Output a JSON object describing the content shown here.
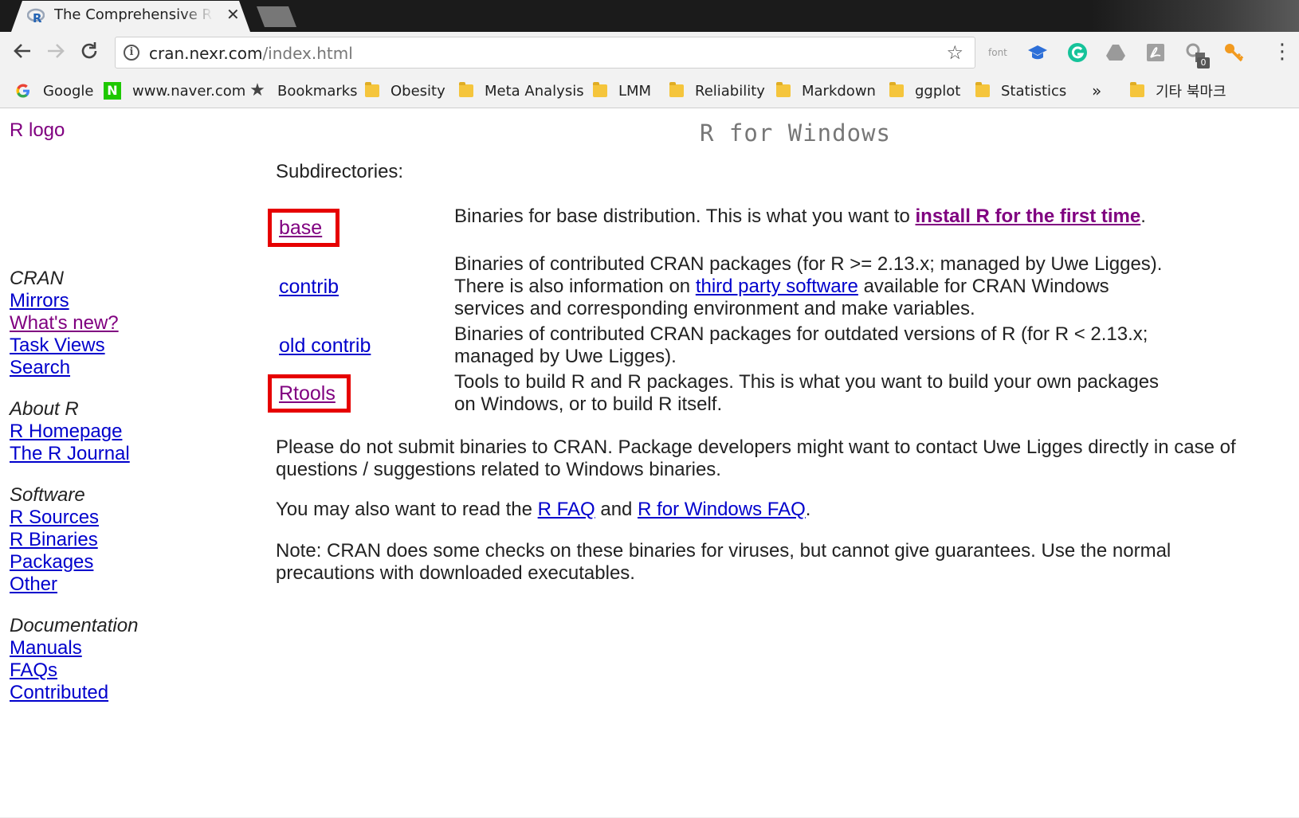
{
  "browser": {
    "tab": {
      "title": "The Comprehensive R Archive Network",
      "close": "✕"
    },
    "url": {
      "host": "cran.nexr.com",
      "path": "/index.html"
    },
    "extension_badge": "0",
    "ext_font_label": "font",
    "bookmarks": [
      {
        "label": "Google",
        "icon": "google-icon"
      },
      {
        "label": "www.naver.com",
        "icon": "naver-icon"
      },
      {
        "label": "Bookmarks",
        "icon": "star-icon"
      },
      {
        "label": "Obesity",
        "icon": "folder-icon"
      },
      {
        "label": "Meta Analysis",
        "icon": "folder-icon"
      },
      {
        "label": "LMM",
        "icon": "folder-icon"
      },
      {
        "label": "Reliability",
        "icon": "folder-icon"
      },
      {
        "label": "Markdown",
        "icon": "folder-icon"
      },
      {
        "label": "ggplot",
        "icon": "folder-icon"
      },
      {
        "label": "Statistics",
        "icon": "folder-icon"
      }
    ],
    "bookmarks_overflow": "»",
    "other_bookmarks": "기타 북마크"
  },
  "page": {
    "logo_alt": "R logo",
    "title": "R for Windows",
    "sidebar": {
      "cran": {
        "heading": "CRAN",
        "links": [
          "Mirrors",
          "What's new?",
          "Task Views",
          "Search"
        ]
      },
      "about": {
        "heading": "About R",
        "links": [
          "R Homepage",
          "The R Journal"
        ]
      },
      "software": {
        "heading": "Software",
        "links": [
          "R Sources",
          "R Binaries",
          "Packages",
          "Other"
        ]
      },
      "documentation": {
        "heading": "Documentation",
        "links": [
          "Manuals",
          "FAQs",
          "Contributed"
        ]
      }
    },
    "subdirectories_heading": "Subdirectories:",
    "dirs": {
      "base": {
        "label": "base",
        "desc_before": "Binaries for base distribution. This is what you want to ",
        "desc_link": "install R for the first time",
        "desc_after": "."
      },
      "contrib": {
        "label": "contrib",
        "desc_before": "Binaries of contributed CRAN packages (for R >= 2.13.x; managed by Uwe Ligges). There is also information on ",
        "desc_link": "third party software",
        "desc_after": " available for CRAN Windows services and corresponding environment and make variables."
      },
      "old_contrib": {
        "label": "old contrib",
        "desc": "Binaries of contributed CRAN packages for outdated versions of R (for R < 2.13.x; managed by Uwe Ligges)."
      },
      "rtools": {
        "label": "Rtools",
        "desc": "Tools to build R and R packages. This is what you want to build your own packages on Windows, or to build R itself."
      }
    },
    "para1": "Please do not submit binaries to CRAN. Package developers might want to contact Uwe Ligges directly in case of questions / suggestions related to Windows binaries.",
    "para2": {
      "before": "You may also want to read the ",
      "link1": "R FAQ",
      "middle": " and ",
      "link2": "R for Windows FAQ",
      "after": "."
    },
    "para3": "Note: CRAN does some checks on these binaries for viruses, but cannot give guarantees. Use the normal precautions with downloaded executables."
  },
  "colors": {
    "link": "#0000cc",
    "visited": "#800080",
    "highlight_box": "#e60000"
  }
}
